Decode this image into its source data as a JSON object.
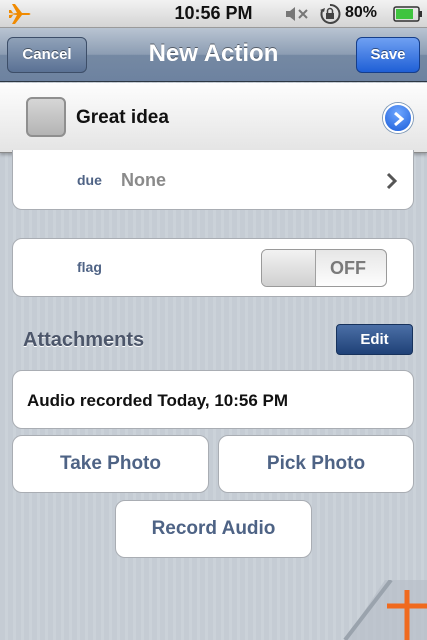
{
  "status_bar": {
    "time": "10:56 PM",
    "battery": "80%",
    "icons": [
      "airplane-icon",
      "mute-icon",
      "orientation-lock-icon",
      "battery-icon"
    ]
  },
  "nav": {
    "cancel": "Cancel",
    "title": "New Action",
    "save": "Save"
  },
  "action": {
    "title": "Great idea",
    "completed": false
  },
  "due": {
    "label": "due",
    "value": "None"
  },
  "flag": {
    "label": "flag",
    "state": "OFF"
  },
  "attachments": {
    "title": "Attachments",
    "edit": "Edit",
    "items": [
      "Audio recorded Today, 10:56 PM"
    ]
  },
  "buttons": {
    "take_photo": "Take Photo",
    "pick_photo": "Pick Photo",
    "record_audio": "Record Audio"
  },
  "colors": {
    "save_blue": "#1f5fd6",
    "label_blue": "#4f6385",
    "corner_orange": "#f06a1e"
  }
}
